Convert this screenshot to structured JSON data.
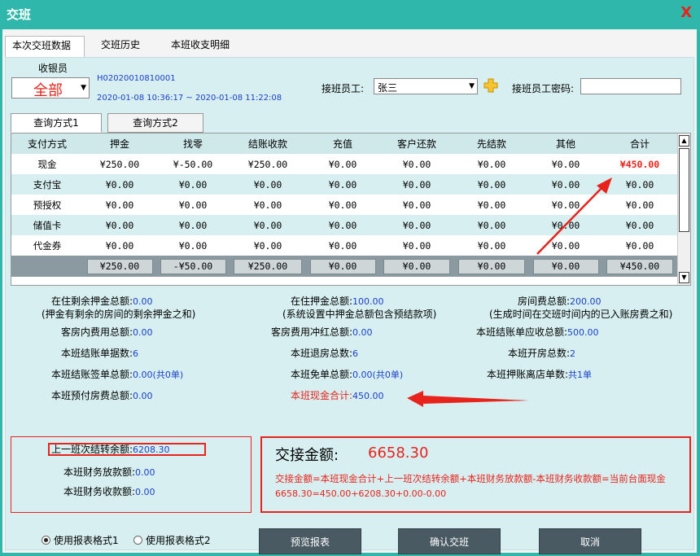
{
  "window": {
    "title": "交班",
    "close_glyph": "X"
  },
  "tabs": [
    {
      "label": "本次交班数据"
    },
    {
      "label": "交班历史"
    },
    {
      "label": "本班收支明细"
    }
  ],
  "header": {
    "cashier_label": "收银员",
    "cashier_value": "全部",
    "shift_no": "H02020010810001",
    "shift_time": "2020-01-08 10:36:17 ~ 2020-01-08 11:22:08",
    "handover_label": "接班员工:",
    "handover_value": "张三",
    "password_label": "接班员工密码:",
    "password_value": ""
  },
  "query_tabs": [
    {
      "label": "查询方式1"
    },
    {
      "label": "查询方式2"
    }
  ],
  "grid": {
    "columns": [
      "支付方式",
      "押金",
      "找零",
      "结账收款",
      "充值",
      "客户还款",
      "先结款",
      "其他",
      "合计"
    ],
    "rows": [
      [
        "现金",
        "¥250.00",
        "¥-50.00",
        "¥250.00",
        "¥0.00",
        "¥0.00",
        "¥0.00",
        "¥0.00",
        "¥450.00"
      ],
      [
        "支付宝",
        "¥0.00",
        "¥0.00",
        "¥0.00",
        "¥0.00",
        "¥0.00",
        "¥0.00",
        "¥0.00",
        "¥0.00"
      ],
      [
        "预授权",
        "¥0.00",
        "¥0.00",
        "¥0.00",
        "¥0.00",
        "¥0.00",
        "¥0.00",
        "¥0.00",
        "¥0.00"
      ],
      [
        "储值卡",
        "¥0.00",
        "¥0.00",
        "¥0.00",
        "¥0.00",
        "¥0.00",
        "¥0.00",
        "¥0.00",
        "¥0.00"
      ],
      [
        "代金券",
        "¥0.00",
        "¥0.00",
        "¥0.00",
        "¥0.00",
        "¥0.00",
        "¥0.00",
        "¥0.00",
        "¥0.00"
      ]
    ],
    "totals": [
      "",
      "¥250.00",
      "-¥50.00",
      "¥250.00",
      "¥0.00",
      "¥0.00",
      "¥0.00",
      "¥0.00",
      "¥450.00"
    ]
  },
  "stats": {
    "remaining_deposit": {
      "k": "在住剩余押金总额:",
      "v": "0.00"
    },
    "remaining_deposit_note": "(押金有剩余的房间的剩余押金之和)",
    "deposit_total": {
      "k": "在住押金总额:",
      "v": "100.00"
    },
    "deposit_total_note": "(系统设置中押金总额包含预结款项)",
    "room_fee": {
      "k": "房间费总额:",
      "v": "200.00"
    },
    "room_fee_note": "(生成时间在交班时间内的已入账房费之和)",
    "room_expense": {
      "k": "客房内费用总额:",
      "v": "0.00"
    },
    "room_expense_offset": {
      "k": "客房费用冲红总额:",
      "v": "0.00"
    },
    "receivable": {
      "k": "本班结账单应收总额:",
      "v": "500.00"
    },
    "checkout_count": {
      "k": "本班结账单据数:",
      "v": "6"
    },
    "checkout_rooms": {
      "k": "本班退房总数:",
      "v": "6"
    },
    "open_rooms": {
      "k": "本班开房总数:",
      "v": "2"
    },
    "signed_total": {
      "k": "本班结账签单总额:",
      "v": "0.00(共0单)"
    },
    "waived_total": {
      "k": "本班免单总额:",
      "v": "0.00(共0单)"
    },
    "pledge_count": {
      "k": "本班押账离店单数:",
      "v": "共1单"
    },
    "prepaid_total": {
      "k": "本班预付房费总额:",
      "v": "0.00"
    },
    "cash_total": {
      "k": "本班现金合计:",
      "v": "450.00"
    }
  },
  "lower": {
    "prev_balance": {
      "k": "上一班次结转余额:",
      "v": "6208.30"
    },
    "finance_out": {
      "k": "本班财务放款额:",
      "v": "0.00"
    },
    "finance_in": {
      "k": "本班财务收款额:",
      "v": "0.00"
    },
    "handover_amount_label": "交接金额:",
    "handover_amount": "6658.30",
    "formula": "交接金额=本班现金合计+上一班次结转余额+本班财务放款额-本班财务收款额=当前台面现金",
    "formula_values": "6658.30=450.00+6208.30+0.00-0.00"
  },
  "bottom": {
    "radio1": "使用报表格式1",
    "radio2": "使用报表格式2",
    "preview_button": "预览报表",
    "confirm_button": "确认交班",
    "cancel_button": "取消"
  },
  "colors": {
    "accent": "#2fb7ab",
    "highlight": "#e8231c",
    "value": "#1a3fc9"
  }
}
